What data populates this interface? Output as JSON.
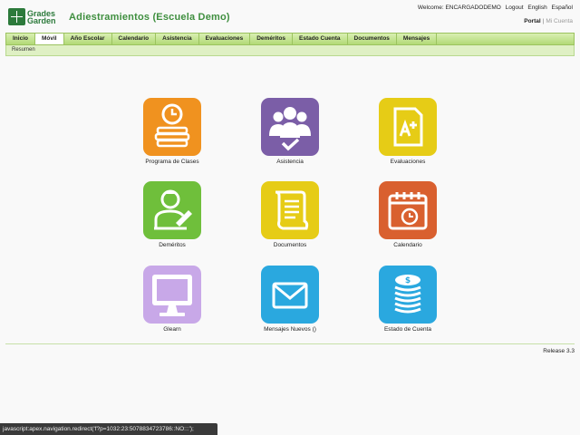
{
  "header": {
    "logo_line1": "Grades",
    "logo_line2": "Garden",
    "title": "Adiestramientos (Escuela Demo)",
    "welcome": "Welcome: ENCARGADODEMO",
    "logout": "Logout",
    "english": "English",
    "espanol": "Español",
    "portal": "Portal",
    "separator": "|",
    "mi_cuenta": "Mi Cuenta"
  },
  "nav": {
    "tabs": [
      "Inicio",
      "Móvil",
      "Año Escolar",
      "Calendario",
      "Asistencia",
      "Evaluaciones",
      "Deméritos",
      "Estado Cuenta",
      "Documentos",
      "Mensajes"
    ],
    "active": "Móvil"
  },
  "subnav": {
    "item": "Resumen"
  },
  "tiles": [
    {
      "label": "Programa de Clases",
      "color": "#f0921f",
      "icon": "schedule-icon"
    },
    {
      "label": "Asistencia",
      "color": "#7b5ea7",
      "icon": "attendance-icon"
    },
    {
      "label": "Evaluaciones",
      "color": "#e6cc16",
      "icon": "grade-document-icon"
    },
    {
      "label": "Deméritos",
      "color": "#6fbf3b",
      "icon": "student-writing-icon"
    },
    {
      "label": "Documentos",
      "color": "#e6cc16",
      "icon": "scroll-icon"
    },
    {
      "label": "Calendario",
      "color": "#d9602f",
      "icon": "calendar-icon"
    },
    {
      "label": "Glearn",
      "color": "#c8a8e8",
      "icon": "monitor-icon"
    },
    {
      "label": "Mensajes Nuevos ()",
      "color": "#2aa8df",
      "icon": "envelope-icon"
    },
    {
      "label": "Estado de Cuenta",
      "color": "#2aa8df",
      "icon": "coins-icon"
    }
  ],
  "footer": {
    "release": "Release 3.3"
  },
  "statusbar": {
    "text": "javascript:apex.navigation.redirect('f?p=1032:23:5078834723786::NO:::');"
  }
}
